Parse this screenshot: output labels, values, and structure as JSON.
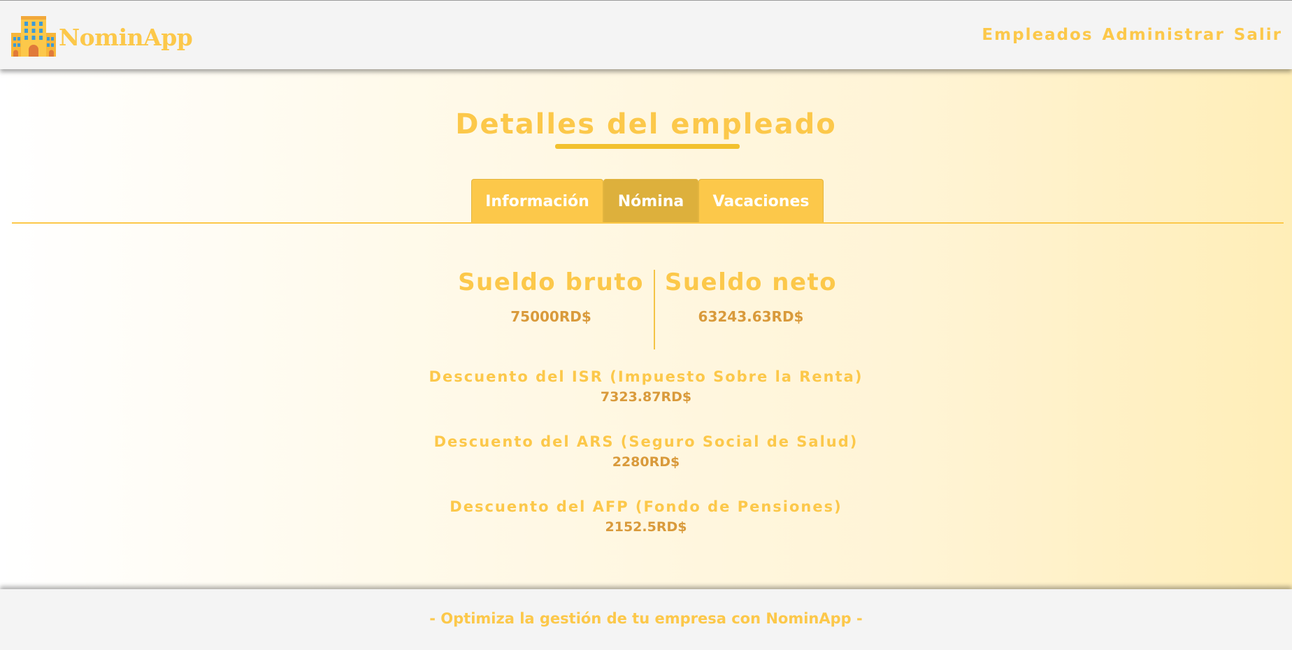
{
  "header": {
    "brand_name": "NominApp",
    "logo_icon": "office-building-icon",
    "nav": [
      "Empleados",
      "Administrar",
      "Salir"
    ]
  },
  "page": {
    "title": "Detalles del empleado"
  },
  "tabs": [
    {
      "label": "Información",
      "active": false
    },
    {
      "label": "Nómina",
      "active": true
    },
    {
      "label": "Vacaciones",
      "active": false
    }
  ],
  "salary": {
    "gross_label": "Sueldo bruto",
    "gross_value": "75000RD$",
    "net_label": "Sueldo neto",
    "net_value": "63243.63RD$"
  },
  "deductions": [
    {
      "label": "Descuento del ISR (Impuesto Sobre la Renta)",
      "value": "7323.87RD$"
    },
    {
      "label": "Descuento del ARS (Seguro Social de Salud)",
      "value": "2280RD$"
    },
    {
      "label": "Descuento del AFP (Fondo de Pensiones)",
      "value": "2152.5RD$"
    }
  ],
  "footer": {
    "text": "- Optimiza la gestión de tu empresa con NominApp -"
  },
  "colors": {
    "accent": "#fcc84a",
    "accent_dark": "#ddb03c",
    "value_text": "#d99a3b",
    "bar_bg": "#f4f4f4"
  }
}
